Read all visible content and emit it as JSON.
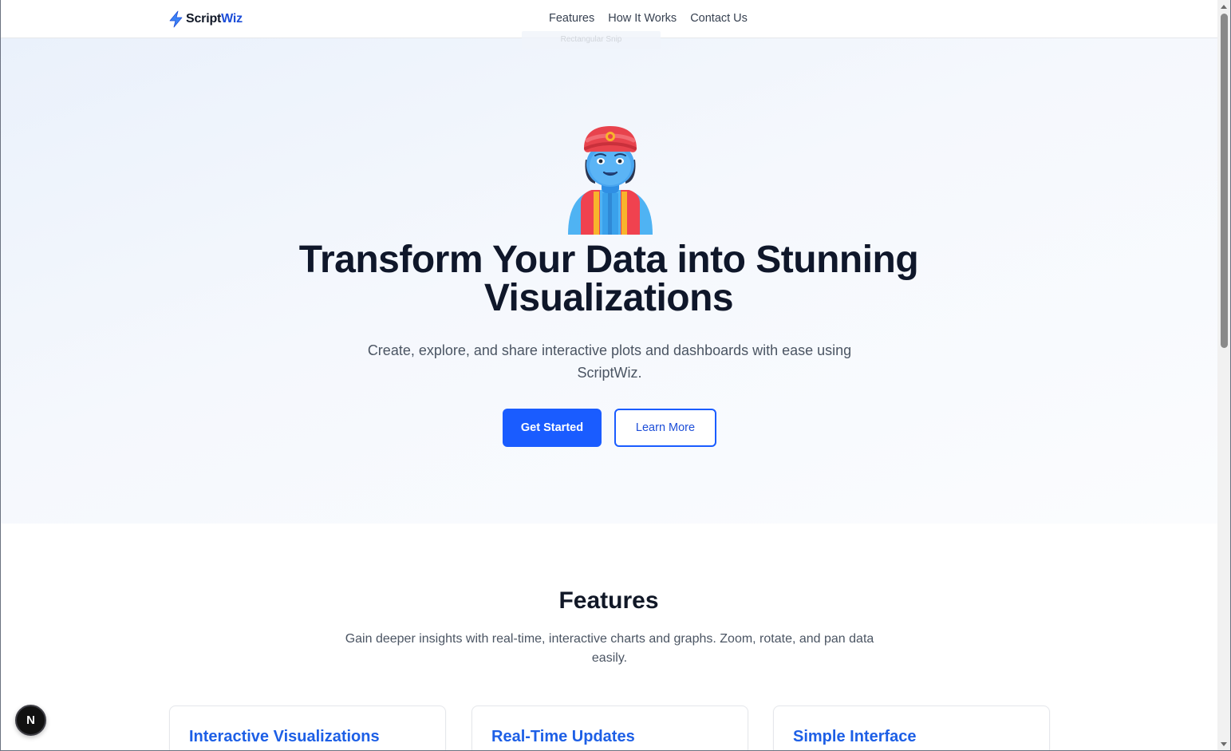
{
  "brand": {
    "name_part1": "Script",
    "name_part2": "Wiz"
  },
  "nav": {
    "items": [
      {
        "label": "Features"
      },
      {
        "label": "How It Works"
      },
      {
        "label": "Contact Us"
      }
    ]
  },
  "overlay": {
    "snip_label": "Rectangular Snip"
  },
  "hero": {
    "title_line1": "Transform Your Data into Stunning",
    "title_line2": "Visualizations",
    "subtitle": "Create, explore, and share interactive plots and dashboards with ease using ScriptWiz.",
    "primary_button": "Get Started",
    "secondary_button": "Learn More"
  },
  "features": {
    "title": "Features",
    "subtitle": "Gain deeper insights with real-time, interactive charts and graphs. Zoom, rotate, and pan data easily.",
    "cards": [
      {
        "title": "Interactive Visualizations"
      },
      {
        "title": "Real-Time Updates"
      },
      {
        "title": "Simple Interface"
      }
    ]
  },
  "dev_badge": {
    "label": "N"
  },
  "colors": {
    "accent": "#1a5cff",
    "accent_text": "#1d4ed8",
    "heading": "#0f172a",
    "body_text": "#4b5563",
    "card_title": "#1d5fe6"
  }
}
